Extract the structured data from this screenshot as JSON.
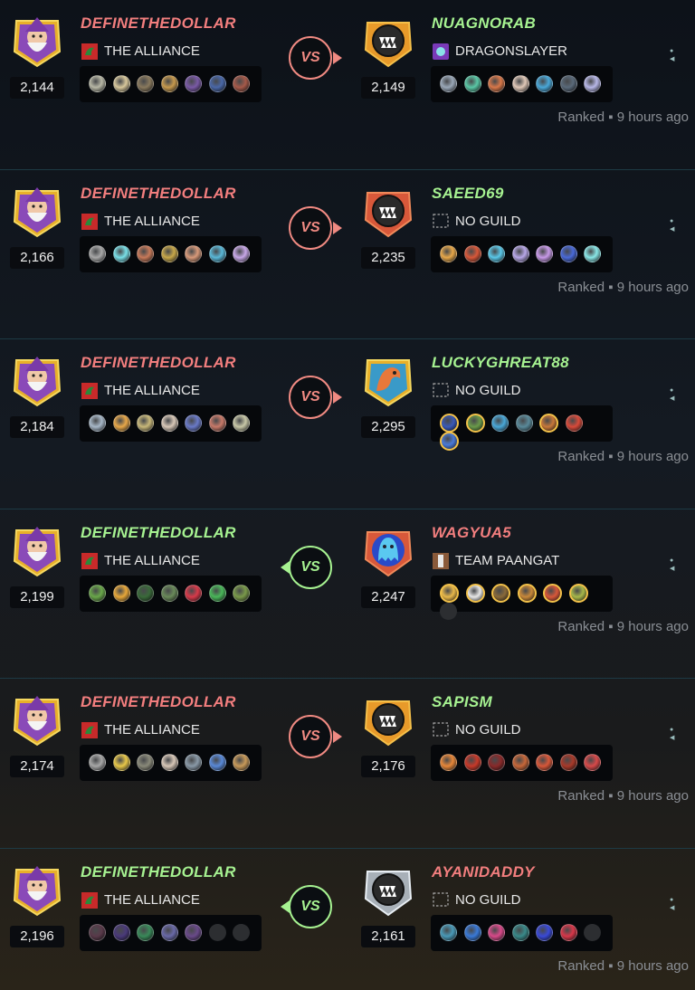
{
  "battles": [
    {
      "left": {
        "name": "DEFINETHEDOLLAR",
        "result": "lose",
        "rating": "2,144",
        "guild": "THE ALLIANCE",
        "guild_icon": "alliance-flag-icon",
        "cards": [
          "#b8b8a6",
          "#d8c89c",
          "#8a7a5e",
          "#c79a4e",
          "#7a5aa6",
          "#4a68a8",
          "#a65a4a"
        ]
      },
      "right": {
        "name": "NUAGNORAB",
        "result": "win",
        "rating": "2,149",
        "guild": "DRAGONSLAYER",
        "guild_icon": "dragonslayer-crest-icon",
        "avatar": "orange-monster-frame",
        "cards": [
          "#9aa8b8",
          "#5ac8a6",
          "#d8784a",
          "#e0c8b8",
          "#4aa8d8",
          "#5a6a7a",
          "#b8b8e8"
        ]
      },
      "vs": "VS",
      "winner_side": "right",
      "meta": "Ranked ▪ 9 hours ago"
    },
    {
      "left": {
        "name": "DEFINETHEDOLLAR",
        "result": "lose",
        "rating": "2,166",
        "guild": "THE ALLIANCE",
        "guild_icon": "alliance-flag-icon",
        "cards": [
          "#a8a8a8",
          "#7ae0e8",
          "#c87a5a",
          "#c8a84a",
          "#d89a7a",
          "#5ab8d8",
          "#c8a8e8"
        ]
      },
      "right": {
        "name": "SAEED69",
        "result": "win",
        "rating": "2,235",
        "guild": "NO GUILD",
        "guild_icon": "no-guild-icon",
        "avatar": "red-monster-frame",
        "cards": [
          "#e8a84a",
          "#d8583a",
          "#5ac8e8",
          "#b8a8e8",
          "#c89ae8",
          "#4a6ad8",
          "#8ae8e8"
        ]
      },
      "vs": "VS",
      "winner_side": "right",
      "meta": "Ranked ▪ 9 hours ago"
    },
    {
      "left": {
        "name": "DEFINETHEDOLLAR",
        "result": "lose",
        "rating": "2,184",
        "guild": "THE ALLIANCE",
        "guild_icon": "alliance-flag-icon",
        "cards": [
          "#a8b8c8",
          "#e8a84a",
          "#c8b87a",
          "#d8c8b8",
          "#6a7ac8",
          "#c87a6a",
          "#c8c8a8"
        ]
      },
      "right": {
        "name": "LUCKYGHREAT88",
        "result": "win",
        "rating": "2,295",
        "guild": "NO GUILD",
        "guild_icon": "no-guild-icon",
        "avatar": "phoenix-gold-frame",
        "cards": [
          "#3a5ab8",
          "#6a9a4a",
          "#4aa8d8",
          "#5a8a9a",
          "#c8783a",
          "#d84a3a",
          "#4a7ad8"
        ],
        "gold": [
          0,
          1,
          4,
          6
        ]
      },
      "vs": "VS",
      "winner_side": "right",
      "meta": "Ranked ▪ 9 hours ago"
    },
    {
      "left": {
        "name": "DEFINETHEDOLLAR",
        "result": "win",
        "rating": "2,199",
        "guild": "THE ALLIANCE",
        "guild_icon": "alliance-flag-icon",
        "cards": [
          "#6aa84a",
          "#e8a83a",
          "#3a6a3a",
          "#6a8a5a",
          "#d83a4a",
          "#4ab85a",
          "#7a9a4a"
        ]
      },
      "right": {
        "name": "WAGYUA5",
        "result": "lose",
        "rating": "2,247",
        "guild": "TEAM PAANGAT",
        "guild_icon": "paangat-crest-icon",
        "avatar": "ghost-red-frame",
        "cards": [
          "#e8b84a",
          "#e8e8e8",
          "#8a6a3a",
          "#c8883a",
          "#d8583a",
          "#a8b84a"
        ],
        "gold": [
          0,
          1,
          2,
          3,
          4,
          5
        ],
        "empty": 1
      },
      "vs": "VS",
      "winner_side": "left",
      "meta": "Ranked ▪ 9 hours ago"
    },
    {
      "left": {
        "name": "DEFINETHEDOLLAR",
        "result": "lose",
        "rating": "2,174",
        "guild": "THE ALLIANCE",
        "guild_icon": "alliance-flag-icon",
        "cards": [
          "#a8a8a8",
          "#e8c84a",
          "#8a8a7a",
          "#d8c8b8",
          "#8a9aa8",
          "#5a8ad8",
          "#c89a5a"
        ]
      },
      "right": {
        "name": "SAPISM",
        "result": "win",
        "rating": "2,176",
        "guild": "NO GUILD",
        "guild_icon": "no-guild-icon",
        "avatar": "orange-monster-frame",
        "cards": [
          "#e8883a",
          "#c83a2a",
          "#8a2a2a",
          "#c8683a",
          "#d8583a",
          "#a83a2a",
          "#d84a4a"
        ]
      },
      "vs": "VS",
      "winner_side": "right",
      "meta": "Ranked ▪ 9 hours ago"
    },
    {
      "left": {
        "name": "DEFINETHEDOLLAR",
        "result": "win",
        "rating": "2,196",
        "guild": "THE ALLIANCE",
        "guild_icon": "alliance-flag-icon",
        "cards": [
          "#5a3a4a",
          "#4a3a7a",
          "#3a8a5a",
          "#6a6aa8",
          "#6a4a8a"
        ],
        "empty": 2
      },
      "right": {
        "name": "AYANIDADDY",
        "result": "lose",
        "rating": "2,161",
        "guild": "NO GUILD",
        "guild_icon": "no-guild-icon",
        "avatar": "silver-monster-frame",
        "cards": [
          "#4a9ab8",
          "#3a7ad8",
          "#d84a8a",
          "#3a8a8a",
          "#3a4ad8",
          "#d8384a"
        ],
        "empty": 1
      },
      "vs": "VS",
      "winner_side": "left",
      "meta": "Ranked ▪ 9 hours ago"
    }
  ],
  "colors": {
    "win": "#a6f291",
    "lose": "#f27e7e",
    "vs_red": "#f08a82",
    "vs_green": "#a6f291"
  }
}
